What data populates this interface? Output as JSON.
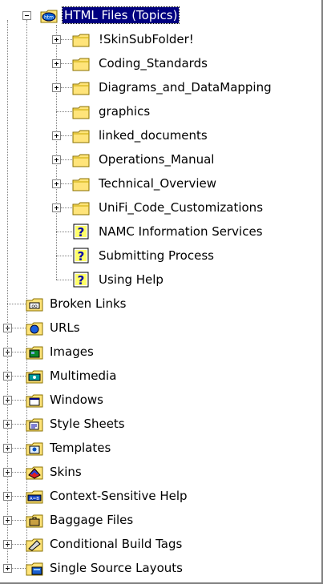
{
  "tree": {
    "root": {
      "label": "HTML Files (Topics)",
      "icon": "html-folder-icon",
      "expanded": true,
      "selected": true
    },
    "children": [
      {
        "label": "!SkinSubFolder!",
        "icon": "folder-icon",
        "expander": "plus"
      },
      {
        "label": "Coding_Standards",
        "icon": "folder-icon",
        "expander": "plus"
      },
      {
        "label": "Diagrams_and_DataMapping",
        "icon": "folder-icon",
        "expander": "plus"
      },
      {
        "label": "graphics",
        "icon": "folder-icon",
        "expander": "none"
      },
      {
        "label": "linked_documents",
        "icon": "folder-icon",
        "expander": "plus"
      },
      {
        "label": "Operations_Manual",
        "icon": "folder-icon",
        "expander": "plus"
      },
      {
        "label": "Technical_Overview",
        "icon": "folder-icon",
        "expander": "plus"
      },
      {
        "label": "UniFi_Code_Customizations",
        "icon": "folder-icon",
        "expander": "plus"
      },
      {
        "label": "NAMC Information Services",
        "icon": "help-topic-icon",
        "expander": "none"
      },
      {
        "label": "Submitting Process",
        "icon": "help-topic-icon",
        "expander": "none"
      },
      {
        "label": "Using Help",
        "icon": "help-topic-icon",
        "expander": "none"
      }
    ],
    "siblings": [
      {
        "label": "Broken Links",
        "icon": "broken-links-icon",
        "expander": "none"
      },
      {
        "label": "URLs",
        "icon": "urls-icon",
        "expander": "plus"
      },
      {
        "label": "Images",
        "icon": "images-icon",
        "expander": "plus"
      },
      {
        "label": "Multimedia",
        "icon": "multimedia-icon",
        "expander": "plus"
      },
      {
        "label": "Windows",
        "icon": "windows-icon",
        "expander": "plus"
      },
      {
        "label": "Style Sheets",
        "icon": "style-sheets-icon",
        "expander": "plus"
      },
      {
        "label": "Templates",
        "icon": "templates-icon",
        "expander": "plus"
      },
      {
        "label": "Skins",
        "icon": "skins-icon",
        "expander": "plus"
      },
      {
        "label": "Context-Sensitive Help",
        "icon": "context-sensitive-help-icon",
        "expander": "plus"
      },
      {
        "label": "Baggage Files",
        "icon": "baggage-files-icon",
        "expander": "plus"
      },
      {
        "label": "Conditional Build Tags",
        "icon": "conditional-build-tags-icon",
        "expander": "plus"
      },
      {
        "label": "Single Source Layouts",
        "icon": "single-source-layouts-icon",
        "expander": "plus"
      }
    ]
  },
  "colors": {
    "selection": "#000080",
    "folder": "#ffde59",
    "help_blue": "#0000aa"
  }
}
